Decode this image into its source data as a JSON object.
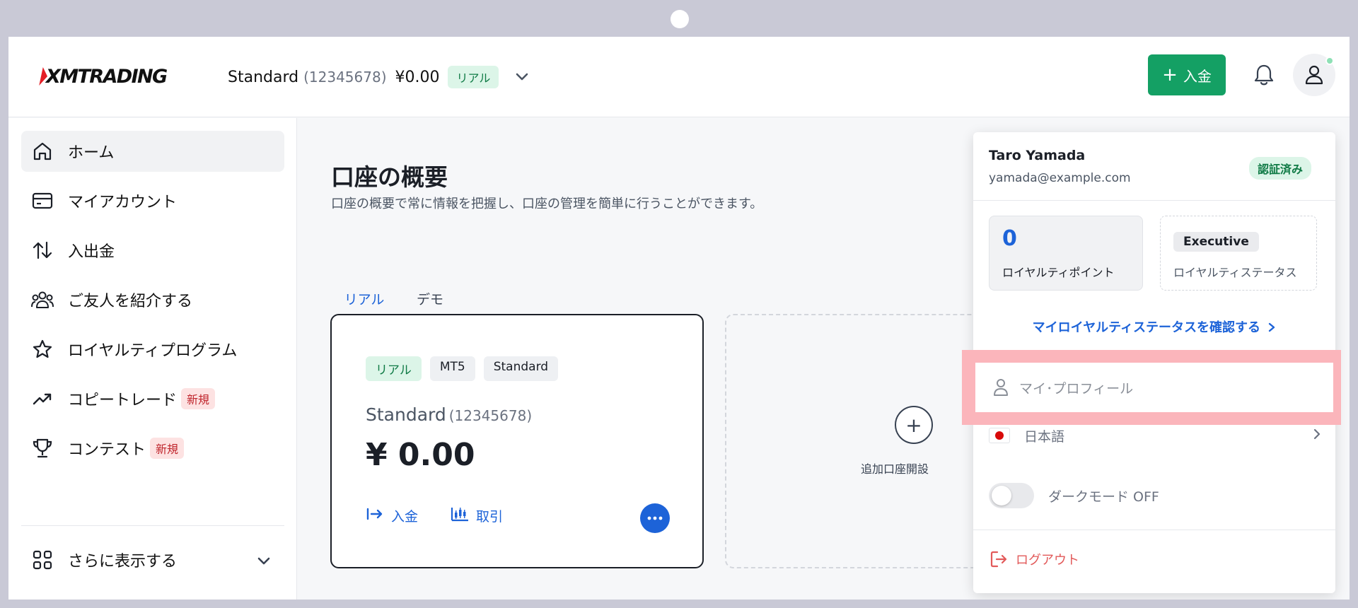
{
  "header": {
    "logo_text": "XMTRADING",
    "account_name": "Standard",
    "account_number": "(12345678)",
    "account_balance": "¥0.00",
    "account_badge": "リアル",
    "deposit_label": "入金"
  },
  "sidebar": {
    "items": [
      {
        "label": "ホーム",
        "icon": "home-icon"
      },
      {
        "label": "マイアカウント",
        "icon": "card-icon"
      },
      {
        "label": "入出金",
        "icon": "transfer-arrows-icon"
      },
      {
        "label": "ご友人を紹介する",
        "icon": "users-icon"
      },
      {
        "label": "ロイヤルティプログラム",
        "icon": "star-icon"
      },
      {
        "label": "コピートレード",
        "icon": "trend-up-icon",
        "badge": "新規"
      },
      {
        "label": "コンテスト",
        "icon": "trophy-icon",
        "badge": "新規"
      }
    ],
    "more_label": "さらに表示する"
  },
  "main": {
    "title": "口座の概要",
    "subtitle": "口座の概要で常に情報を把握し、口座の管理を簡単に行うことができます。",
    "tabs": [
      {
        "label": "リアル",
        "active": true
      },
      {
        "label": "デモ",
        "active": false
      }
    ],
    "account_card": {
      "chips": [
        "リアル",
        "MT5",
        "Standard"
      ],
      "name": "Standard",
      "number": "(12345678)",
      "balance": "¥ 0.00",
      "deposit_label": "入金",
      "trade_label": "取引"
    },
    "add_account_label": "追加口座開設"
  },
  "profile_menu": {
    "name": "Taro Yamada",
    "email": "yamada@example.com",
    "verified_label": "認証済み",
    "loyalty_points_value": "0",
    "loyalty_points_label": "ロイヤルティポイント",
    "status_value": "Executive",
    "status_label": "ロイヤルティステータス",
    "status_link": "マイロイヤルティステータスを確認する",
    "profile_label": "マイ･プロフィール",
    "language_label": "日本語",
    "dark_mode_label": "ダークモード OFF",
    "logout_label": "ログアウト"
  },
  "colors": {
    "primary_green": "#14a064",
    "link_blue": "#1d63d8",
    "highlight": "#fbb5bb",
    "new_badge": "#c0262d"
  }
}
